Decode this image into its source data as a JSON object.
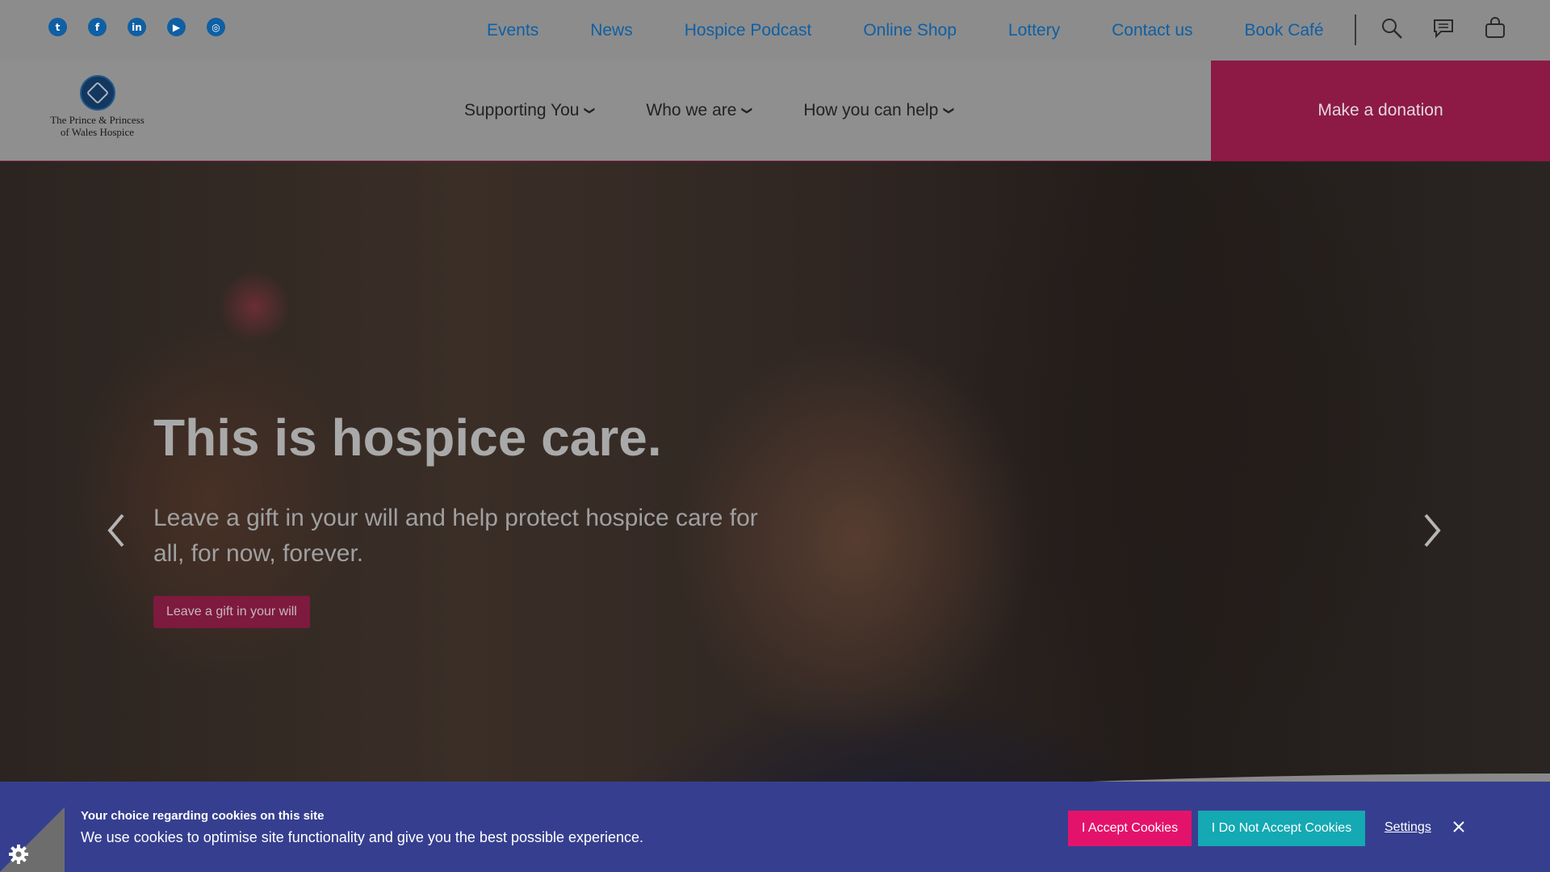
{
  "social": {
    "items": [
      {
        "icon": "twitter-icon",
        "glyph": "t"
      },
      {
        "icon": "facebook-icon",
        "glyph": "f"
      },
      {
        "icon": "linkedin-icon",
        "glyph": "in"
      },
      {
        "icon": "youtube-icon",
        "glyph": "▶"
      },
      {
        "icon": "instagram-icon",
        "glyph": "◎"
      }
    ]
  },
  "topnav": {
    "links": [
      "Events",
      "News",
      "Hospice Podcast",
      "Online Shop",
      "Lottery",
      "Contact us",
      "Book Café"
    ],
    "icons": [
      "search-icon",
      "chat-icon",
      "basket-icon"
    ]
  },
  "logo": {
    "line1": "The Prince & Princess",
    "line2": "of Wales Hospice"
  },
  "mainnav": {
    "items": [
      "Supporting You",
      "Who we are",
      "How you can help"
    ],
    "donate_label": "Make a donation"
  },
  "hero": {
    "title": "This is hospice care.",
    "subtitle": "Leave a gift in your will and help protect hospice care for all, for now, forever.",
    "button_label": "Leave a gift in your will"
  },
  "cookie": {
    "title": "Your choice regarding cookies on this site",
    "text": "We use cookies to optimise site functionality and give you the best possible experience.",
    "accept_label": "I Accept Cookies",
    "decline_label": "I Do Not Accept Cookies",
    "settings_label": "Settings"
  },
  "colors": {
    "link_blue": "#0f5fa3",
    "donate_bg": "#8c1a44",
    "cookie_bg": "#363f8f",
    "accept_bg": "#e3136b",
    "decline_bg": "#14a9b3"
  }
}
